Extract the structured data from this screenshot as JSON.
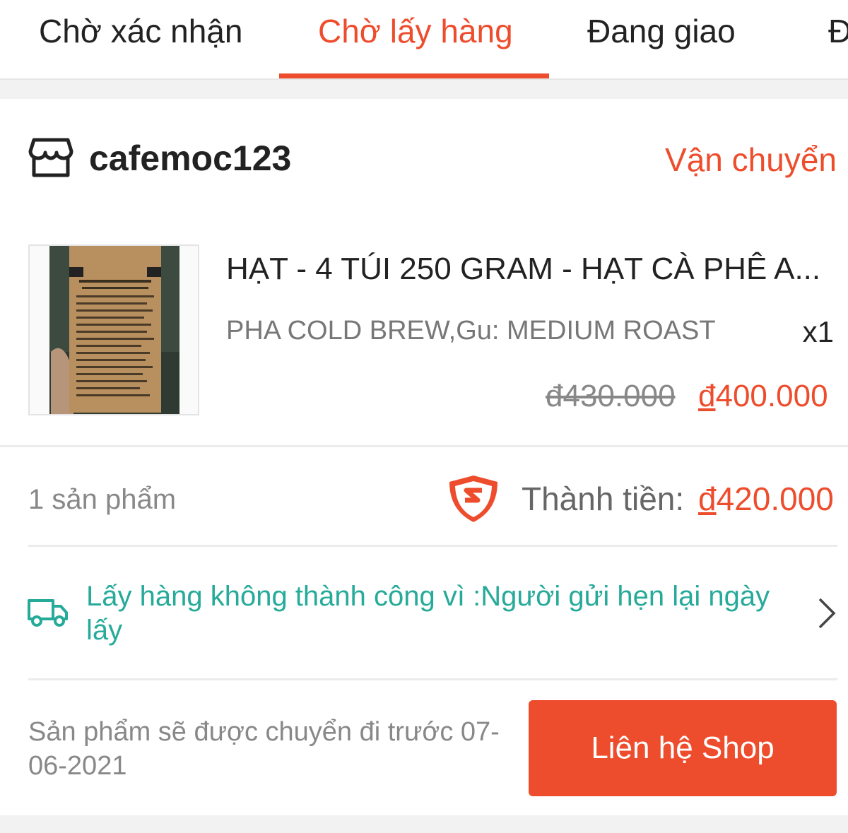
{
  "tabs": [
    {
      "label": "Chờ xác nhận"
    },
    {
      "label": "Chờ lấy hàng"
    },
    {
      "label": "Đang giao"
    },
    {
      "label": "Đ"
    }
  ],
  "shop": {
    "name": "cafemoc123",
    "shipping_status": "Vận chuyển"
  },
  "product": {
    "name": "HẠT - 4 TÚI 250 GRAM - HẠT CÀ PHÊ A...",
    "variation": "PHA COLD BREW,Gu: MEDIUM ROAST",
    "quantity": "x1",
    "currency_symbol": "đ",
    "original_price": "430.000",
    "price": "400.000",
    "image_icon": "coffee-bag-photo"
  },
  "summary": {
    "item_count": "1 sản phẩm",
    "total_label": "Thành tiền: ",
    "currency_symbol": "đ",
    "total": "420.000"
  },
  "shipping": {
    "status_message": "Lấy hàng không thành công vì :Người gửi hẹn lại ngày lấy"
  },
  "footer": {
    "ship_note": "Sản phẩm sẽ được chuyển đi trước 07-06-2021",
    "contact_button": "Liên hệ Shop"
  },
  "colors": {
    "accent": "#ee4d2d",
    "status_teal": "#26aa99",
    "muted_text": "#888888"
  }
}
